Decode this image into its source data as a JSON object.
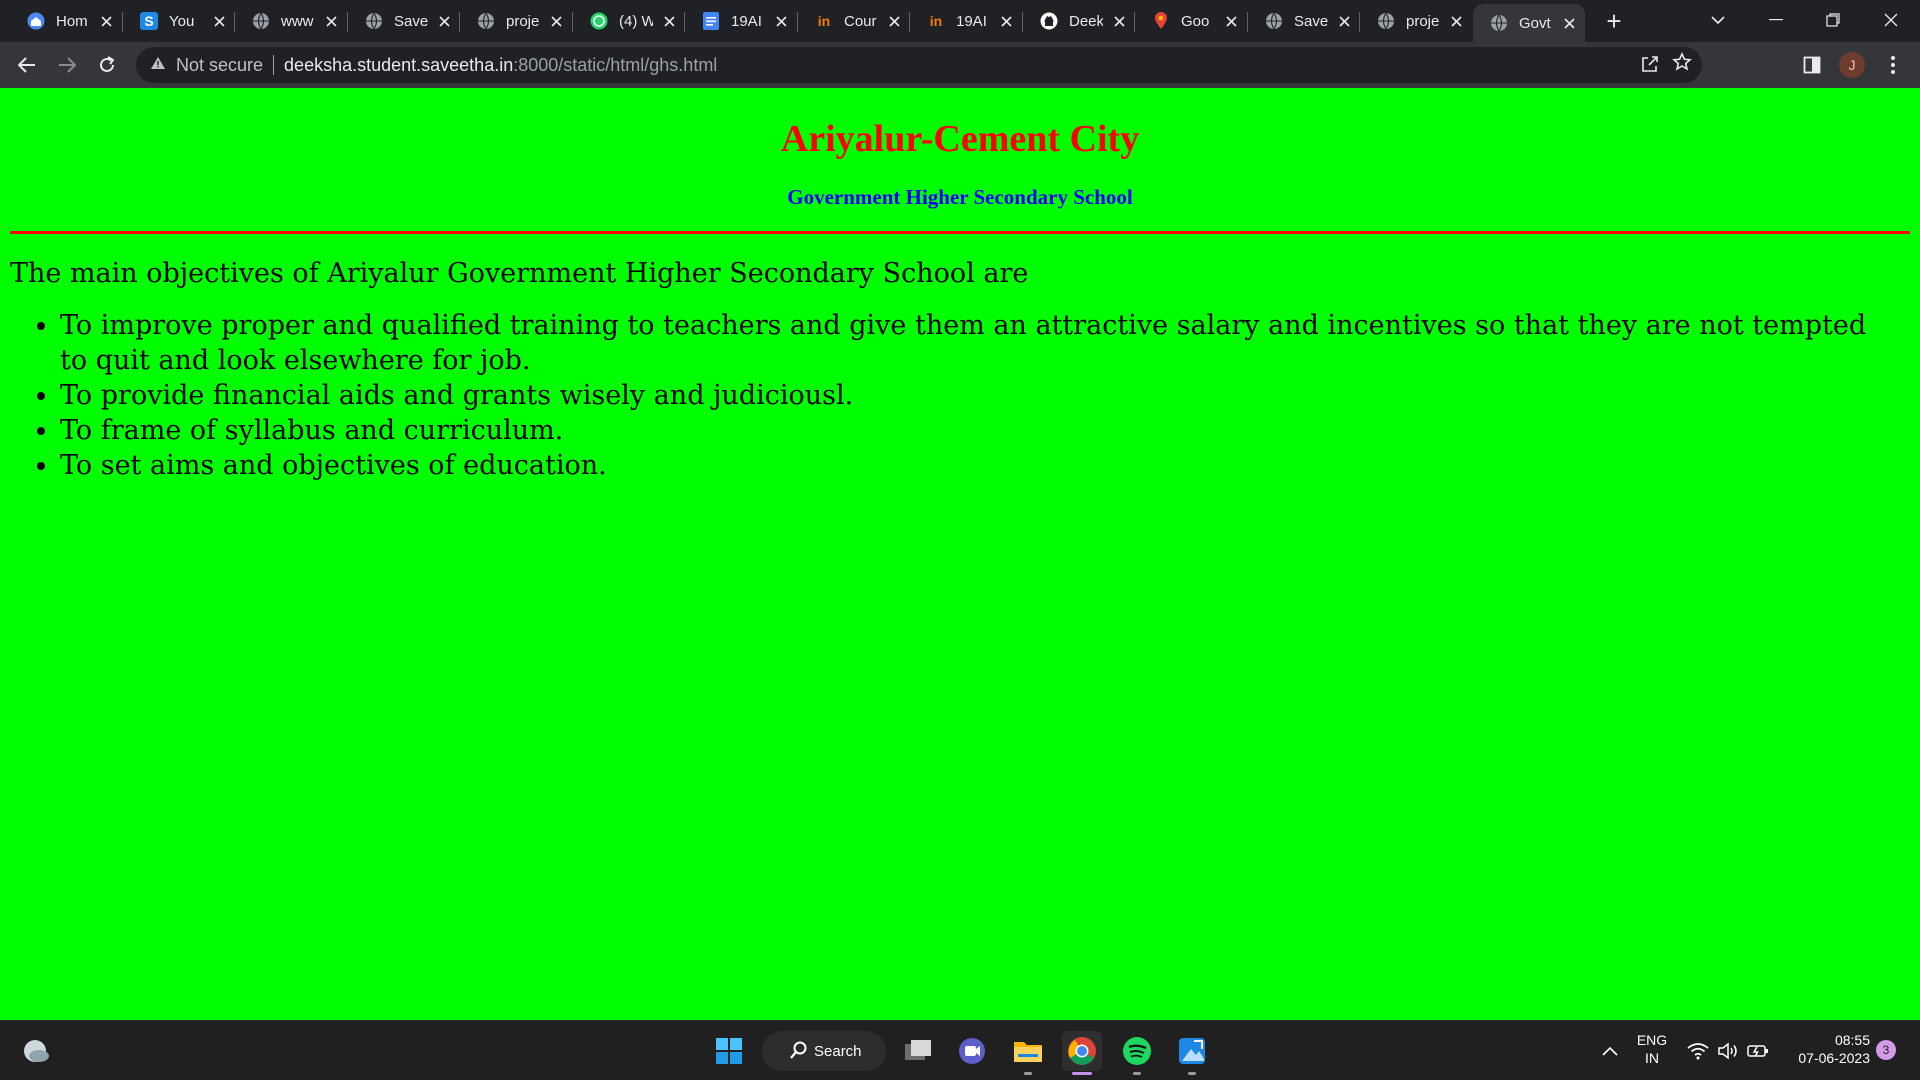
{
  "browser": {
    "tabs": [
      {
        "title": "Hom",
        "icon": "home-app-icon",
        "icon_color": "#4a8af4",
        "active": false
      },
      {
        "title": "You",
        "icon": "s-letter-icon",
        "icon_color": "#1e88e5",
        "active": false
      },
      {
        "title": "www",
        "icon": "globe-icon",
        "icon_color": "#9aa0a6",
        "active": false
      },
      {
        "title": "Save",
        "icon": "globe-icon",
        "icon_color": "#9aa0a6",
        "active": false
      },
      {
        "title": "proje",
        "icon": "globe-icon",
        "icon_color": "#9aa0a6",
        "active": false
      },
      {
        "title": "(4) W",
        "icon": "whatsapp-icon",
        "icon_color": "#25d366",
        "active": false
      },
      {
        "title": "19AI",
        "icon": "docs-icon",
        "icon_color": "#4285f4",
        "active": false
      },
      {
        "title": "Cour",
        "icon": "in-logo-icon",
        "icon_color": "#f57c00",
        "active": false
      },
      {
        "title": "19AI",
        "icon": "in-logo-icon",
        "icon_color": "#f57c00",
        "active": false
      },
      {
        "title": "Deek",
        "icon": "github-icon",
        "icon_color": "#ffffff",
        "active": false
      },
      {
        "title": "Goo",
        "icon": "maps-pin-icon",
        "icon_color": "#ea4335",
        "active": false
      },
      {
        "title": "Save",
        "icon": "globe-icon",
        "icon_color": "#9aa0a6",
        "active": false
      },
      {
        "title": "proje",
        "icon": "globe-icon",
        "icon_color": "#9aa0a6",
        "active": false
      },
      {
        "title": "Govt",
        "icon": "globe-icon",
        "icon_color": "#9aa0a6",
        "active": true
      }
    ],
    "omnibox": {
      "security_label": "Not secure",
      "url_host": "deeksha.student.saveetha.in",
      "url_rest": ":8000/static/html/ghs.html"
    },
    "profile_initial": "J"
  },
  "page": {
    "background": "#00ff00",
    "heading": "Ariyalur-Cement City",
    "heading_color": "#ff0000",
    "subheading": "Government Higher Secondary School",
    "subheading_color": "#0000ff",
    "intro": "The main objectives of Ariyalur Government Higher Secondary School are",
    "objectives": [
      "To improve proper and qualified training to teachers and give them an attractive salary and incentives so that they are not tempted to quit and look elsewhere for job.",
      "To provide financial aids and grants wisely and judiciousl.",
      "To frame of syllabus and curriculum.",
      "To set aims and objectives of education."
    ]
  },
  "taskbar": {
    "search_label": "Search",
    "language": "ENG",
    "region": "IN",
    "time": "08:55",
    "date": "07-06-2023",
    "notification_count": "3"
  }
}
